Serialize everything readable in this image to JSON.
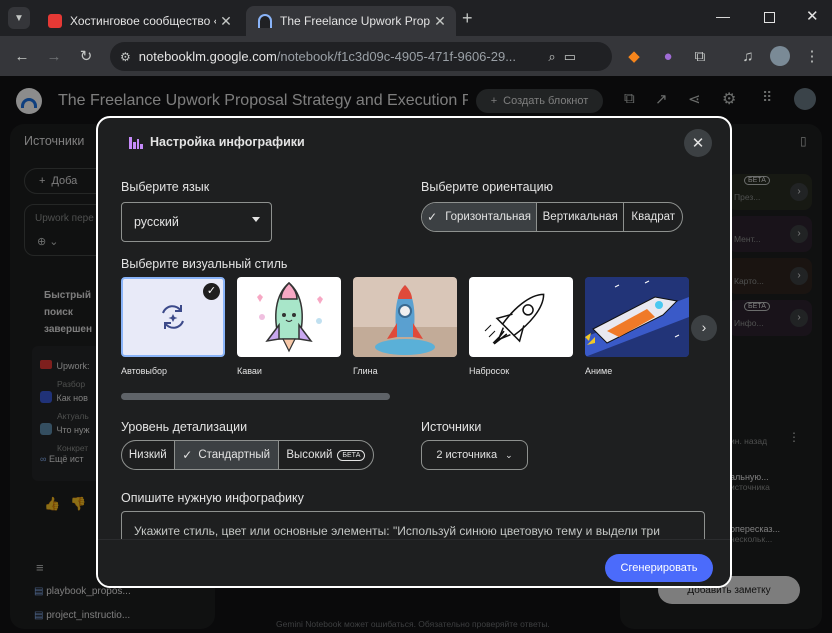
{
  "browser": {
    "tabs": [
      {
        "title": "Хостинговое сообщество «Tim",
        "active": false
      },
      {
        "title": "The Freelance Upwork Proposal",
        "active": true
      }
    ],
    "url_host": "notebooklm.google.com",
    "url_path": "/notebook/f1c3d09c-4905-471f-9606-29..."
  },
  "app": {
    "title": "The Freelance Upwork Proposal Strategy and Execution Pl",
    "create_button": "Создать блокнот",
    "sources_header": "Источники",
    "add_label": "Доба",
    "search_placeholder": "Upwork пере",
    "quick_search": [
      "Быстрый",
      "поиск",
      "завершен"
    ],
    "source_items": [
      {
        "title": "Upwork:",
        "sub": "Разбор"
      },
      {
        "title": "Как нов",
        "sub": "Актуаль"
      },
      {
        "title": "Что нуж",
        "sub": "Конкрет"
      },
      {
        "title": "Ещё ист",
        "sub": ""
      }
    ],
    "files": [
      "playbook_propos...",
      "project_instructio..."
    ],
    "studio_items": [
      {
        "badge": "БЕТА",
        "text": "През..."
      },
      {
        "badge": "",
        "text": "Мент..."
      },
      {
        "badge": "",
        "text": "Карто..."
      },
      {
        "badge": "БЕТА",
        "text": "Инфо..."
      }
    ],
    "notes": [
      {
        "title": "",
        "sub": "ин. назад"
      },
      {
        "title": "альную...",
        "sub": "источника"
      },
      {
        "title": "опересказ...",
        "sub": "нескольк..."
      }
    ],
    "add_note": "Добавить заметку",
    "footer": "Gemini Notebook может ошибаться. Обязательно проверяйте ответы."
  },
  "modal": {
    "title": "Настройка инфографики",
    "language_label": "Выберите язык",
    "language_value": "русский",
    "orientation_label": "Выберите ориентацию",
    "orientations": [
      "Горизонтальная",
      "Вертикальная",
      "Квадрат"
    ],
    "orientation_selected": 0,
    "style_label": "Выберите визуальный стиль",
    "styles": [
      "Автовыбор",
      "Каваи",
      "Глина",
      "Набросок",
      "Аниме"
    ],
    "style_selected": 0,
    "detail_label": "Уровень детализации",
    "details": [
      "Низкий",
      "Стандартный",
      "Высокий"
    ],
    "detail_beta": "БЕТА",
    "detail_selected": 1,
    "sources_label": "Источники",
    "sources_value": "2 источника",
    "describe_label": "Опишите нужную инфографику",
    "describe_text": "Укажите стиль, цвет или основные элементы: \"Используй синюю цветовую тему и выдели три",
    "generate_button": "Сгенерировать"
  }
}
